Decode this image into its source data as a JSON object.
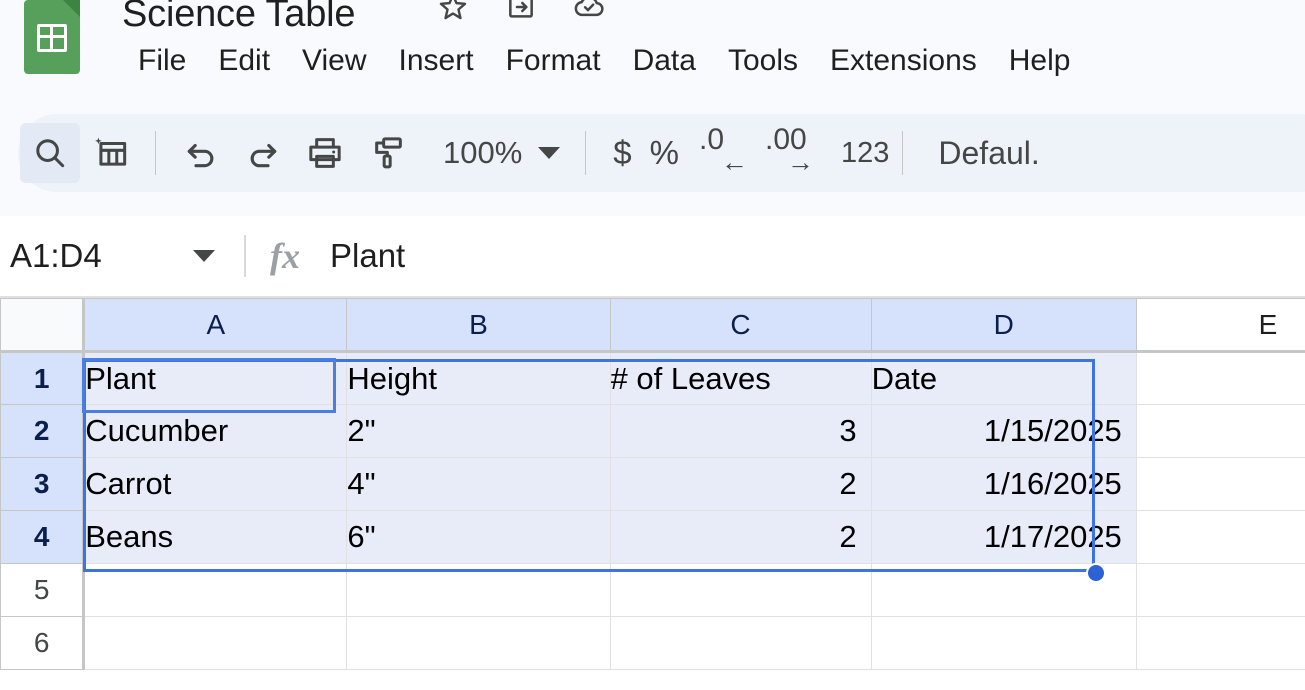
{
  "app": {
    "product": "Google Sheets",
    "doc_title": "Science Table",
    "logo_color": "#57a05b"
  },
  "title_icons": [
    {
      "name": "star-icon",
      "label": "Star"
    },
    {
      "name": "move-to-folder-icon",
      "label": "Move"
    },
    {
      "name": "cloud-saved-icon",
      "label": "Saved to Drive"
    }
  ],
  "menubar": {
    "items": [
      {
        "label": "File"
      },
      {
        "label": "Edit"
      },
      {
        "label": "View"
      },
      {
        "label": "Insert"
      },
      {
        "label": "Format"
      },
      {
        "label": "Data"
      },
      {
        "label": "Tools"
      },
      {
        "label": "Extensions"
      },
      {
        "label": "Help"
      }
    ]
  },
  "toolbar": {
    "search_label": "Search",
    "table_label": "Create a table",
    "undo_label": "Undo",
    "redo_label": "Redo",
    "print_label": "Print",
    "paint_label": "Paint format",
    "zoom_value": "100%",
    "currency_label": "$",
    "percent_label": "%",
    "decrease_decimal_digit": ".0",
    "decrease_decimal_arrow": "←",
    "increase_decimal_digit": ".00",
    "increase_decimal_arrow": "→",
    "more_formats_label": "123",
    "font_label": "Defaul.",
    "accent_color": "#eef2f9"
  },
  "formula_bar": {
    "name_box_value": "A1:D4",
    "fx_label": "fx",
    "formula_value": "Plant"
  },
  "spreadsheet": {
    "column_headers": [
      "A",
      "B",
      "C",
      "D",
      "E"
    ],
    "selected_columns": [
      "A",
      "B",
      "C",
      "D"
    ],
    "row_headers": [
      "1",
      "2",
      "3",
      "4",
      "5",
      "6"
    ],
    "selected_rows": [
      "1",
      "2",
      "3",
      "4"
    ],
    "selection_range": "A1:D4",
    "active_cell": "A1",
    "selection_color": "#3f73df",
    "selected_cell_fill": "#e8ecf8",
    "header_highlight": "#d6e2fb",
    "rows": [
      {
        "row": "1",
        "selected": true,
        "cells": [
          {
            "col": "A",
            "value": "Plant",
            "align": "left",
            "selected": true
          },
          {
            "col": "B",
            "value": "Height",
            "align": "left",
            "selected": true
          },
          {
            "col": "C",
            "value": "# of Leaves",
            "align": "left",
            "selected": true
          },
          {
            "col": "D",
            "value": "Date",
            "align": "left",
            "selected": true
          },
          {
            "col": "E",
            "value": "",
            "align": "left",
            "selected": false
          }
        ]
      },
      {
        "row": "2",
        "selected": true,
        "cells": [
          {
            "col": "A",
            "value": "Cucumber",
            "align": "left",
            "selected": true
          },
          {
            "col": "B",
            "value": "2\"",
            "align": "left",
            "selected": true
          },
          {
            "col": "C",
            "value": "3",
            "align": "right",
            "selected": true
          },
          {
            "col": "D",
            "value": "1/15/2025",
            "align": "right",
            "selected": true
          },
          {
            "col": "E",
            "value": "",
            "align": "left",
            "selected": false
          }
        ]
      },
      {
        "row": "3",
        "selected": true,
        "cells": [
          {
            "col": "A",
            "value": "Carrot",
            "align": "left",
            "selected": true
          },
          {
            "col": "B",
            "value": "4\"",
            "align": "left",
            "selected": true
          },
          {
            "col": "C",
            "value": "2",
            "align": "right",
            "selected": true
          },
          {
            "col": "D",
            "value": "1/16/2025",
            "align": "right",
            "selected": true
          },
          {
            "col": "E",
            "value": "",
            "align": "left",
            "selected": false
          }
        ]
      },
      {
        "row": "4",
        "selected": true,
        "cells": [
          {
            "col": "A",
            "value": "Beans",
            "align": "left",
            "selected": true
          },
          {
            "col": "B",
            "value": "6\"",
            "align": "left",
            "selected": true
          },
          {
            "col": "C",
            "value": "2",
            "align": "right",
            "selected": true
          },
          {
            "col": "D",
            "value": "1/17/2025",
            "align": "right",
            "selected": true
          },
          {
            "col": "E",
            "value": "",
            "align": "left",
            "selected": false
          }
        ]
      },
      {
        "row": "5",
        "selected": false,
        "cells": [
          {
            "col": "A",
            "value": "",
            "align": "left",
            "selected": false
          },
          {
            "col": "B",
            "value": "",
            "align": "left",
            "selected": false
          },
          {
            "col": "C",
            "value": "",
            "align": "left",
            "selected": false
          },
          {
            "col": "D",
            "value": "",
            "align": "left",
            "selected": false
          },
          {
            "col": "E",
            "value": "",
            "align": "left",
            "selected": false
          }
        ]
      },
      {
        "row": "6",
        "selected": false,
        "cells": [
          {
            "col": "A",
            "value": "",
            "align": "left",
            "selected": false
          },
          {
            "col": "B",
            "value": "",
            "align": "left",
            "selected": false
          },
          {
            "col": "C",
            "value": "",
            "align": "left",
            "selected": false
          },
          {
            "col": "D",
            "value": "",
            "align": "left",
            "selected": false
          },
          {
            "col": "E",
            "value": "",
            "align": "left",
            "selected": false
          }
        ]
      }
    ]
  }
}
